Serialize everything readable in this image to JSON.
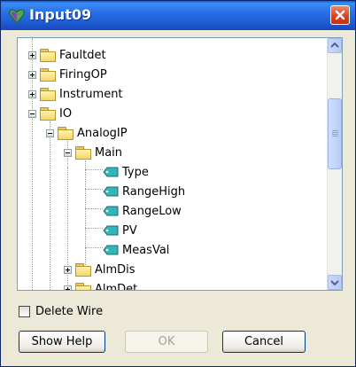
{
  "window": {
    "title": "Input09",
    "icon": "heart-app-icon",
    "close_icon": "close-icon"
  },
  "tree": {
    "nodes": [
      {
        "label": "Faultdet",
        "expander": "plus",
        "icon": "folder-icon"
      },
      {
        "label": "FiringOP",
        "expander": "plus",
        "icon": "folder-icon"
      },
      {
        "label": "Instrument",
        "expander": "plus",
        "icon": "folder-icon"
      },
      {
        "label": "IO",
        "expander": "minus",
        "icon": "folder-icon"
      },
      {
        "label": "AnalogIP",
        "expander": "minus",
        "icon": "folder-icon"
      },
      {
        "label": "Main",
        "expander": "minus",
        "icon": "folder-icon"
      },
      {
        "label": "Type",
        "icon": "tag-icon"
      },
      {
        "label": "RangeHigh",
        "icon": "tag-icon"
      },
      {
        "label": "RangeLow",
        "icon": "tag-icon"
      },
      {
        "label": "PV",
        "icon": "tag-icon"
      },
      {
        "label": "MeasVal",
        "icon": "tag-icon"
      },
      {
        "label": "AlmDis",
        "expander": "plus",
        "icon": "folder-icon"
      },
      {
        "label": "AlmDet",
        "expander": "plus",
        "icon": "folder-icon"
      }
    ]
  },
  "delete_wire": {
    "label": "Delete Wire",
    "checked": false
  },
  "buttons": {
    "show_help": "Show Help",
    "ok": "OK",
    "cancel": "Cancel"
  },
  "colors": {
    "titlebar": "#2a6fe8",
    "close": "#d6401c",
    "dialog_bg": "#ece9d8"
  }
}
